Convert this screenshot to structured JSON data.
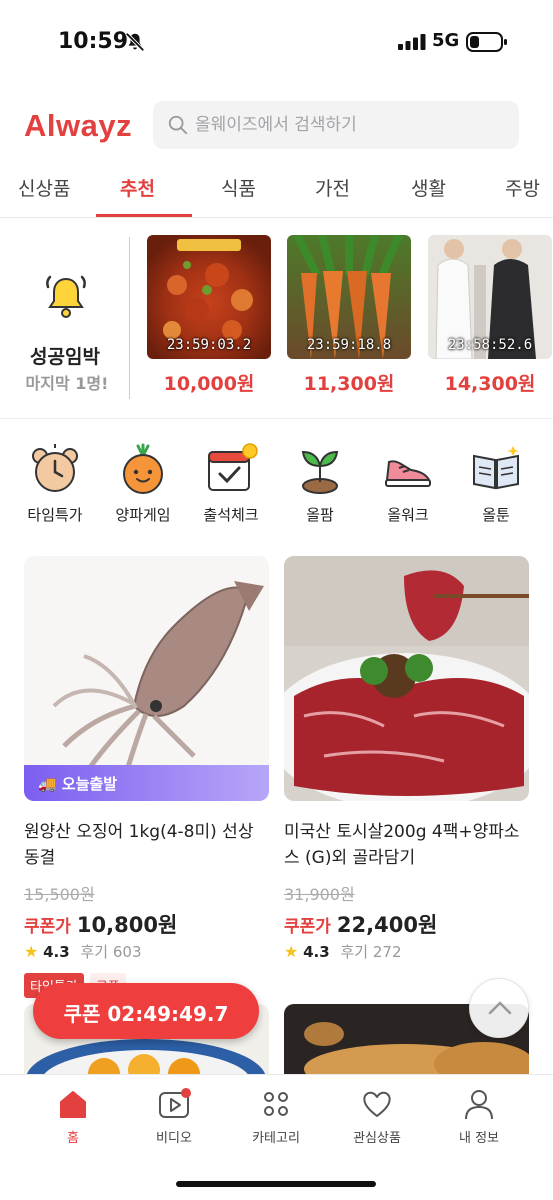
{
  "status_bar": {
    "time": "10:59",
    "network": "5G"
  },
  "header": {
    "logo": "Alwayz",
    "search_placeholder": "올웨이즈에서 검색하기"
  },
  "tabs": [
    "신상품",
    "추천",
    "식품",
    "가전",
    "생활",
    "주방"
  ],
  "active_tab": "추천",
  "flash": {
    "title": "성공임박",
    "subtitle": "마지막 1명!",
    "deals": [
      {
        "timer": "23:59:03.2",
        "price": "10,000원"
      },
      {
        "timer": "23:59:18.8",
        "price": "11,300원"
      },
      {
        "timer": "23:58:52.6",
        "price": "14,300원"
      }
    ]
  },
  "menu": [
    {
      "label": "타임특가",
      "icon": "clock-bear-icon"
    },
    {
      "label": "양파게임",
      "icon": "onion-icon"
    },
    {
      "label": "출석체크",
      "icon": "calendar-check-icon"
    },
    {
      "label": "올팜",
      "icon": "sprout-icon"
    },
    {
      "label": "올워크",
      "icon": "sneaker-icon"
    },
    {
      "label": "올툰",
      "icon": "book-icon"
    }
  ],
  "products": [
    {
      "badge": "오늘출발",
      "name": "원양산 오징어 1kg(4-8미) 선상동결",
      "original_price": "15,500원",
      "coupon_label": "쿠폰가",
      "coupon_price": "10,800원",
      "rating": "4.3",
      "reviews": "후기 603",
      "tags": [
        "타임특가",
        "쿠폰"
      ]
    },
    {
      "badge": "",
      "name": "미국산 토시살200g 4팩+양파소스 (G)외 골라담기",
      "original_price": "31,900원",
      "coupon_label": "쿠폰가",
      "coupon_price": "22,400원",
      "rating": "4.3",
      "reviews": "후기 272",
      "tags": []
    }
  ],
  "coupon_timer": "쿠폰 02:49:49.7",
  "bottom_nav": [
    {
      "label": "홈",
      "icon": "home-icon"
    },
    {
      "label": "비디오",
      "icon": "video-icon"
    },
    {
      "label": "카테고리",
      "icon": "category-icon"
    },
    {
      "label": "관심상품",
      "icon": "heart-icon"
    },
    {
      "label": "내 정보",
      "icon": "profile-icon"
    }
  ],
  "colors": {
    "accent": "#e3413f",
    "badge_purple": "#7b5ef0"
  }
}
